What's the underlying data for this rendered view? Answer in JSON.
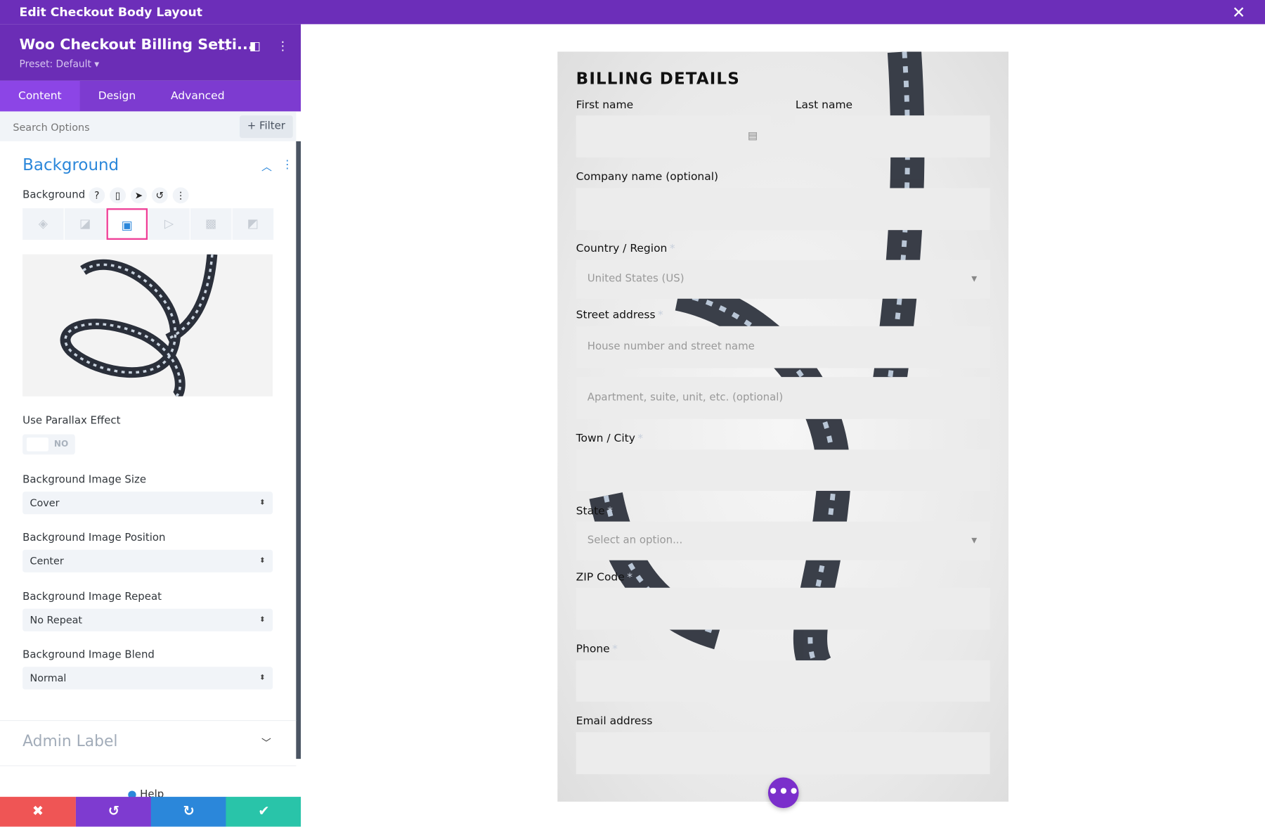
{
  "window": {
    "title": "Edit Checkout Body Layout",
    "close_icon": "close-icon"
  },
  "panel": {
    "module_title": "Woo Checkout Billing Setti...",
    "preset": "Preset: Default ▾",
    "tabs": [
      {
        "label": "Content",
        "active": true
      },
      {
        "label": "Design"
      },
      {
        "label": "Advanced"
      }
    ],
    "search_placeholder": "Search Options",
    "filter_label": "+ Filter",
    "section_title": "Background",
    "background_label": "Background",
    "background_types": [
      "color",
      "gradient",
      "image",
      "video",
      "pattern",
      "mask"
    ],
    "active_background_type": "image",
    "parallax_label": "Use Parallax Effect",
    "parallax_value": "NO",
    "settings": [
      {
        "label": "Background Image Size",
        "value": "Cover"
      },
      {
        "label": "Background Image Position",
        "value": "Center"
      },
      {
        "label": "Background Image Repeat",
        "value": "No Repeat"
      },
      {
        "label": "Background Image Blend",
        "value": "Normal"
      }
    ],
    "admin_label": "Admin Label",
    "help": "Help",
    "footer_colors": {
      "discard": "#ef5555",
      "undo": "#7e3bd0",
      "redo": "#2b87da",
      "save": "#29c4a9"
    }
  },
  "form": {
    "title": "BILLING DETAILS",
    "fields": {
      "first_name": "First name",
      "last_name": "Last name",
      "company": "Company name (optional)",
      "country": "Country / Region",
      "country_value": "United States (US)",
      "street": "Street address",
      "street_placeholder": "House number and street name",
      "apt_placeholder": "Apartment, suite, unit, etc. (optional)",
      "city": "Town / City",
      "state": "State",
      "state_placeholder": "Select an option...",
      "zip": "ZIP Code",
      "phone": "Phone",
      "email": "Email address"
    },
    "required_mark": "*",
    "more_button": "•••"
  }
}
